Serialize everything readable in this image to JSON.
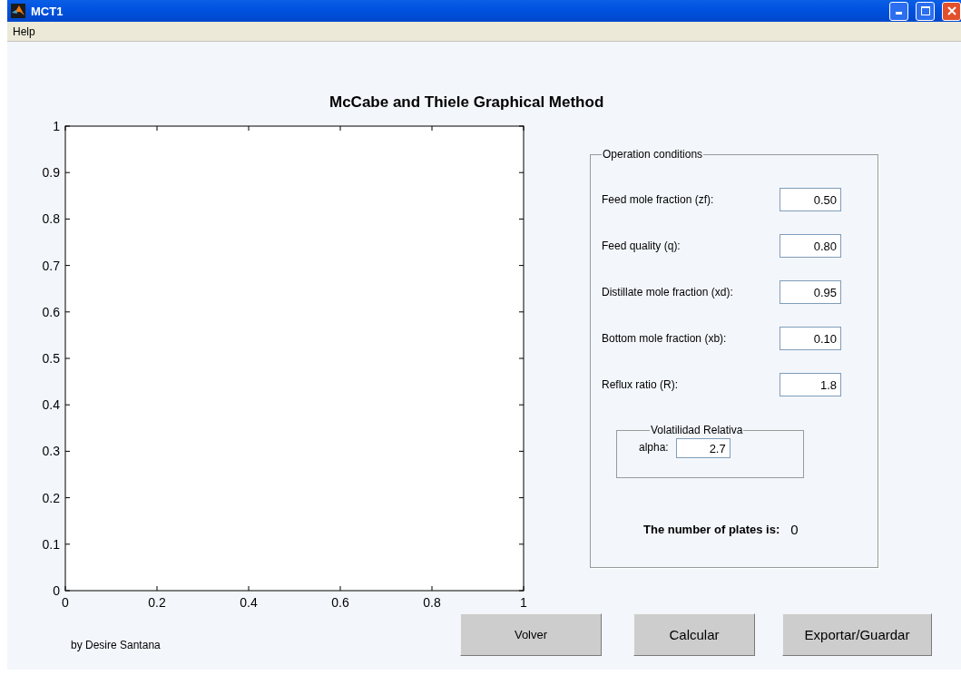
{
  "window": {
    "title": "MCT1"
  },
  "menu": [
    "Help"
  ],
  "plot": {
    "title": "McCabe and Thiele Graphical Method",
    "chart_data": {
      "type": "line",
      "xlim": [
        0,
        1
      ],
      "ylim": [
        0,
        1
      ],
      "xticks": [
        0,
        0.2,
        0.4,
        0.6,
        0.8,
        1
      ],
      "yticks": [
        0,
        0.1,
        0.2,
        0.3,
        0.4,
        0.5,
        0.6,
        0.7,
        0.8,
        0.9,
        1
      ]
    }
  },
  "operation_conditions": {
    "title": "Operation conditions",
    "fields": [
      {
        "label": "Feed mole fraction (zf):",
        "value": "0.50"
      },
      {
        "label": "Feed quality (q):",
        "value": "0.80"
      },
      {
        "label": "Distillate mole fraction (xd):",
        "value": "0.95"
      },
      {
        "label": "Bottom mole fraction (xb):",
        "value": "0.10"
      },
      {
        "label": "Reflux ratio (R):",
        "value": "1.8"
      }
    ],
    "volatility": {
      "title": "Volatilidad Relativa",
      "label": "alpha:",
      "value": "2.7"
    },
    "result": {
      "label": "The number of plates is:",
      "value": "0"
    }
  },
  "credit": "by Desire Santana",
  "buttons": [
    "Volver",
    "Calcular",
    "Exportar/Guardar"
  ]
}
